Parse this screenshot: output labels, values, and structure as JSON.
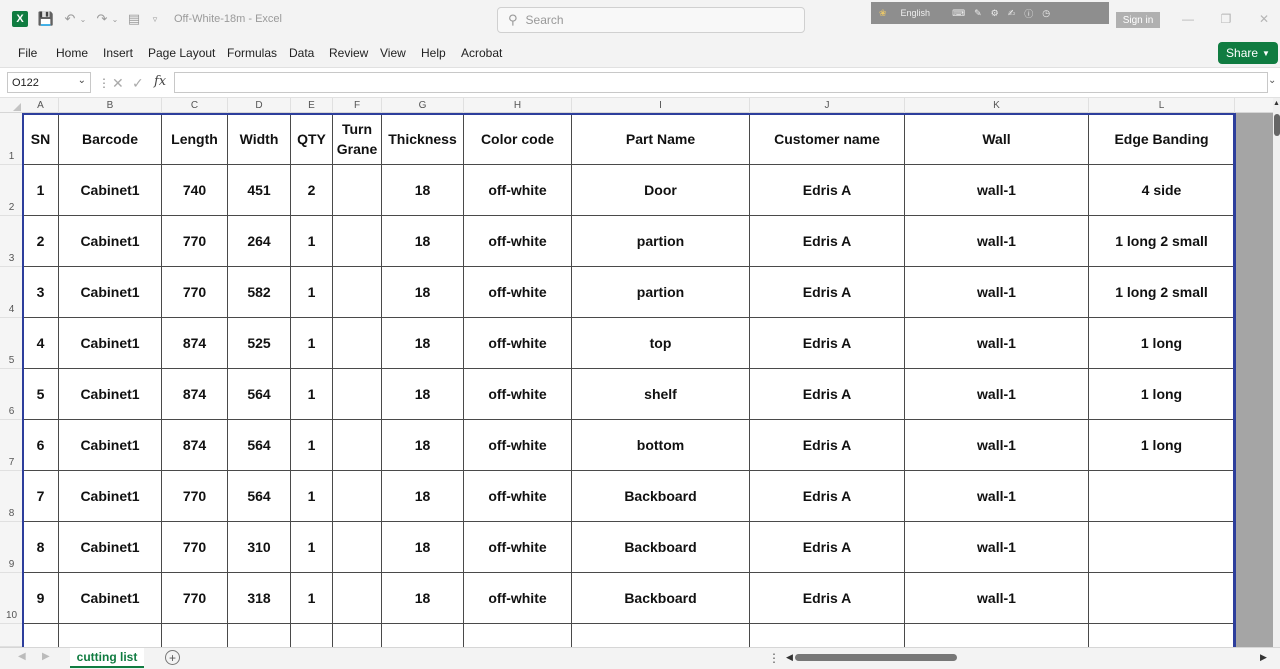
{
  "app": {
    "doc_title": "Off-White-18m  -  Excel",
    "search_placeholder": "Search",
    "ime_language": "English",
    "sign_in": "Sign in"
  },
  "menu": {
    "items": [
      "File",
      "Home",
      "Insert",
      "Page Layout",
      "Formulas",
      "Data",
      "Review",
      "View",
      "Help",
      "Acrobat"
    ],
    "share_label": "Share"
  },
  "formula_bar": {
    "name_box": "O122",
    "fx_label": "fx",
    "formula": ""
  },
  "columns": [
    "A",
    "B",
    "C",
    "D",
    "E",
    "F",
    "G",
    "H",
    "I",
    "J",
    "K",
    "L"
  ],
  "row_numbers": [
    "1",
    "2",
    "3",
    "4",
    "5",
    "6",
    "7",
    "8",
    "9",
    "10"
  ],
  "table": {
    "headers": [
      "SN",
      "Barcode",
      "Length",
      "Width",
      "QTY",
      "Turn Grane",
      "Thickness",
      "Color code",
      "Part Name",
      "Customer name",
      "Wall",
      "Edge Banding"
    ],
    "rows": [
      [
        "1",
        "Cabinet1",
        "740",
        "451",
        "2",
        "",
        "18",
        "off-white",
        "Door",
        "Edris A",
        "wall-1",
        "4 side"
      ],
      [
        "2",
        "Cabinet1",
        "770",
        "264",
        "1",
        "",
        "18",
        "off-white",
        "partion",
        "Edris A",
        "wall-1",
        "1 long 2 small"
      ],
      [
        "3",
        "Cabinet1",
        "770",
        "582",
        "1",
        "",
        "18",
        "off-white",
        "partion",
        "Edris A",
        "wall-1",
        "1 long 2 small"
      ],
      [
        "4",
        "Cabinet1",
        "874",
        "525",
        "1",
        "",
        "18",
        "off-white",
        "top",
        "Edris A",
        "wall-1",
        "1 long"
      ],
      [
        "5",
        "Cabinet1",
        "874",
        "564",
        "1",
        "",
        "18",
        "off-white",
        "shelf",
        "Edris A",
        "wall-1",
        "1 long"
      ],
      [
        "6",
        "Cabinet1",
        "874",
        "564",
        "1",
        "",
        "18",
        "off-white",
        "bottom",
        "Edris A",
        "wall-1",
        "1 long"
      ],
      [
        "7",
        "Cabinet1",
        "770",
        "564",
        "1",
        "",
        "18",
        "off-white",
        "Backboard",
        "Edris A",
        "wall-1",
        ""
      ],
      [
        "8",
        "Cabinet1",
        "770",
        "310",
        "1",
        "",
        "18",
        "off-white",
        "Backboard",
        "Edris A",
        "wall-1",
        ""
      ],
      [
        "9",
        "Cabinet1",
        "770",
        "318",
        "1",
        "",
        "18",
        "off-white",
        "Backboard",
        "Edris A",
        "wall-1",
        ""
      ]
    ]
  },
  "sheets": {
    "active": "cutting list"
  },
  "colors": {
    "excel_green": "#107c41",
    "table_border_blue": "#2d3e9c",
    "gray_fill": "#a5a5a5"
  }
}
